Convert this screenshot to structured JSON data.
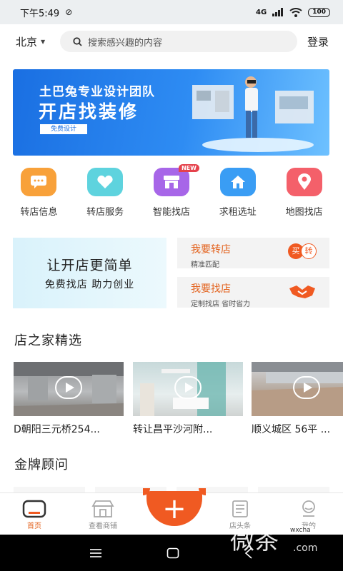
{
  "status_bar": {
    "time": "下午5:49",
    "network": "4G",
    "battery": "100"
  },
  "header": {
    "city": "北京",
    "search_placeholder": "搜索感兴趣的内容",
    "login_label": "登录"
  },
  "banner": {
    "subtitle": "土巴兔专业设计团队",
    "title": "开店找装修",
    "button_label": "免费设计"
  },
  "nav": [
    {
      "label": "转店信息",
      "icon": "chat-icon",
      "color": "#f8a13a"
    },
    {
      "label": "转店服务",
      "icon": "heart-icon",
      "color": "#5ed3de"
    },
    {
      "label": "智能找店",
      "icon": "store-icon",
      "color": "#a766e8",
      "badge": "NEW"
    },
    {
      "label": "求租选址",
      "icon": "home-icon",
      "color": "#3a9df4"
    },
    {
      "label": "地图找店",
      "icon": "location-pin-icon",
      "color": "#f4606a"
    }
  ],
  "promo": {
    "title": "让开店更简单",
    "subtitle": "免费找店 助力创业",
    "cards": [
      {
        "title": "我要转店",
        "subtitle": "精准匹配",
        "icon_buy": "买",
        "icon_transfer": "转"
      },
      {
        "title": "我要找店",
        "subtitle": "定制找店 省时省力",
        "icon": "handshake-icon"
      }
    ]
  },
  "sections": {
    "featured_title": "店之家精选",
    "advisors_title": "金牌顾问"
  },
  "listings": [
    {
      "title": "D朝阳三元桥254..."
    },
    {
      "title": "转让昌平沙河附..."
    },
    {
      "title": "顺义城区 56平 ..."
    }
  ],
  "bottom_nav": {
    "tabs": [
      {
        "label": "首页",
        "icon": "home-tab-icon",
        "active": true
      },
      {
        "label": "查看商铺",
        "icon": "shop-tab-icon",
        "active": false
      },
      {
        "label": "店头条",
        "icon": "news-tab-icon",
        "active": false
      },
      {
        "label": "我的",
        "icon": "profile-tab-icon",
        "active": false
      }
    ],
    "fab_label": "+"
  },
  "accent_color": "#f05a22",
  "watermark": {
    "text": "微茶",
    "tag": "wxcha",
    "url": ".com"
  }
}
